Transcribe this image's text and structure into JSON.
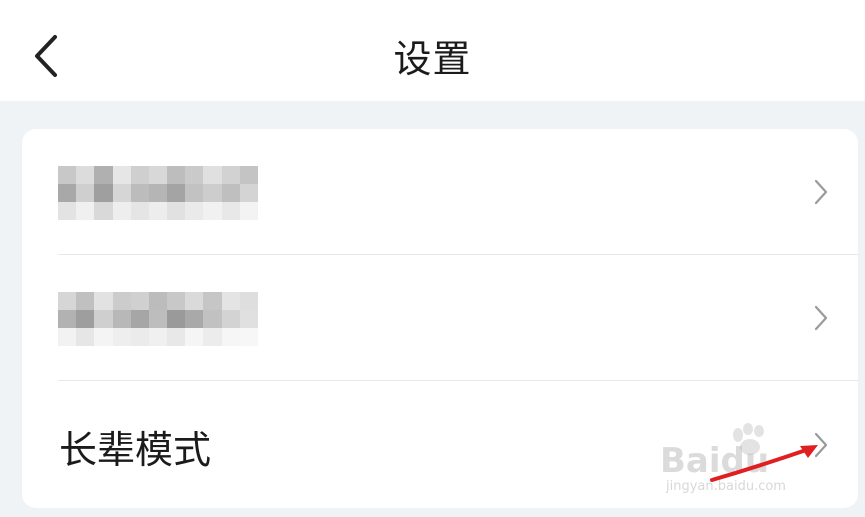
{
  "header": {
    "title": "设置",
    "back_icon": "chevron-left-icon"
  },
  "settings": {
    "items": [
      {
        "label": "",
        "blurred": true,
        "chevron_icon": "chevron-right-icon"
      },
      {
        "label": "",
        "blurred": true,
        "chevron_icon": "chevron-right-icon"
      },
      {
        "label": "长辈模式",
        "blurred": false,
        "chevron_icon": "chevron-right-icon"
      }
    ]
  },
  "watermark": {
    "brand": "Baidu",
    "url": "jingyan.baidu.com"
  },
  "colors": {
    "background": "#f0f3f6",
    "card": "#ffffff",
    "text": "#1b1b1b",
    "chevron": "#9a9a9a",
    "annotation_arrow": "#e02020"
  }
}
